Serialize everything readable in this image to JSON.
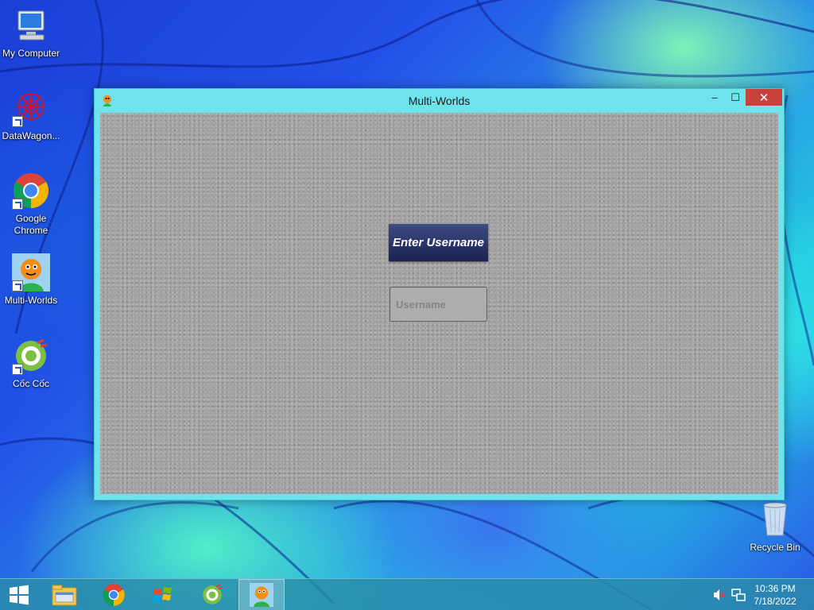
{
  "desktop": {
    "icons": [
      {
        "label": "My Computer",
        "icon": "computer-icon"
      },
      {
        "label": "DataWagon...",
        "icon": "datawagon-icon"
      },
      {
        "label": "Google Chrome",
        "icon": "chrome-icon"
      },
      {
        "label": "Multi-Worlds",
        "icon": "multi-worlds-icon"
      },
      {
        "label": "Cốc Cốc",
        "icon": "coccoc-icon"
      }
    ],
    "recycle_bin": {
      "label": "Recycle Bin",
      "icon": "recycle-bin-icon"
    }
  },
  "window": {
    "title": "Multi-Worlds",
    "minimize_glyph": "‒",
    "maximize_glyph": "☐",
    "close_glyph": "✕",
    "banner_text": "Enter Username",
    "username_input": {
      "value": "",
      "placeholder": "Username"
    }
  },
  "taskbar": {
    "items": [
      {
        "icon": "windows-start-icon",
        "active": false
      },
      {
        "icon": "file-explorer-icon",
        "active": false
      },
      {
        "icon": "chrome-icon",
        "active": false
      },
      {
        "icon": "windows-flag-icon",
        "active": false
      },
      {
        "icon": "coccoc-icon",
        "active": false
      },
      {
        "icon": "multi-worlds-icon",
        "active": true
      }
    ],
    "tray": {
      "volume_icon": "volume-muted-icon",
      "network_icon": "network-icon",
      "time": "10:36 PM",
      "date": "7/18/2022"
    }
  },
  "colors": {
    "window_frame": "#6fe3ec",
    "close_button": "#c7423a",
    "banner_bg": "#2a3468",
    "client_bg": "#a4a4a4"
  }
}
